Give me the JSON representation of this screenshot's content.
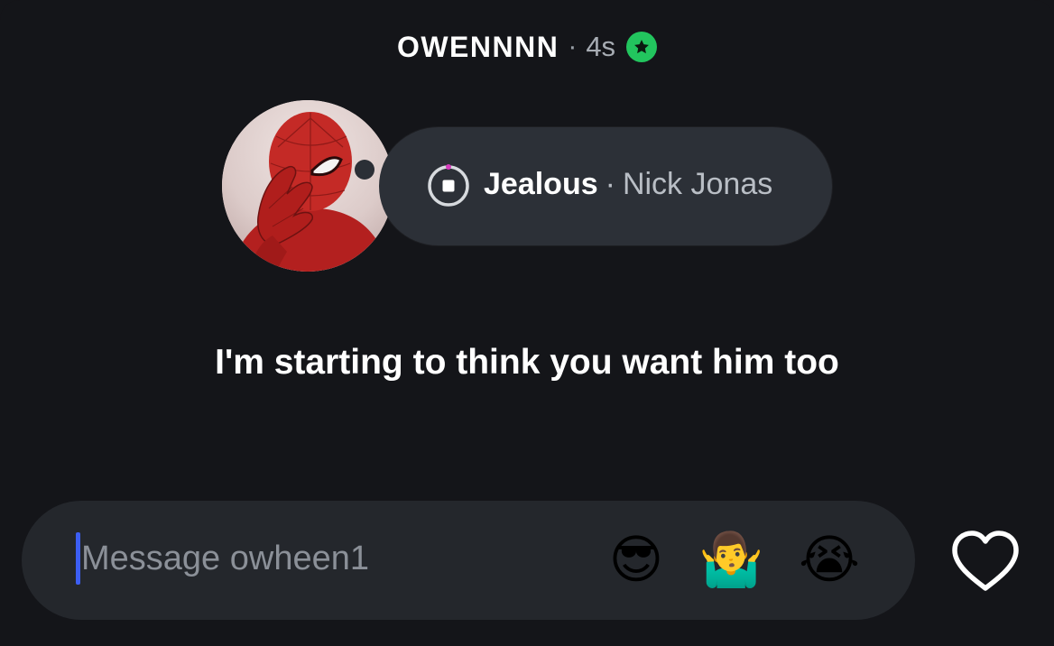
{
  "header": {
    "username": "OWENNNN",
    "separator": "·",
    "time": "4s",
    "close_friends_icon": "star-icon",
    "close_friends_color": "#22c55e"
  },
  "note": {
    "icon": "music-stop-icon",
    "song_title": "Jealous",
    "separator": "·",
    "artist": "Nick Jonas"
  },
  "caption": "I'm starting to think you want him too",
  "message_bar": {
    "placeholder": "Message owheen1",
    "value": "",
    "quick_reactions": [
      {
        "name": "sunglasses-emoji",
        "glyph": "😎"
      },
      {
        "name": "shrug-emoji",
        "glyph": "🤷‍♂️"
      },
      {
        "name": "loudly-crying-emoji",
        "glyph": "😭"
      }
    ],
    "caret_color": "#3c5ef3"
  },
  "like": {
    "icon": "heart-icon"
  },
  "colors": {
    "background": "#141519",
    "bubble": "#2c3037",
    "message_bar": "#24272c"
  }
}
